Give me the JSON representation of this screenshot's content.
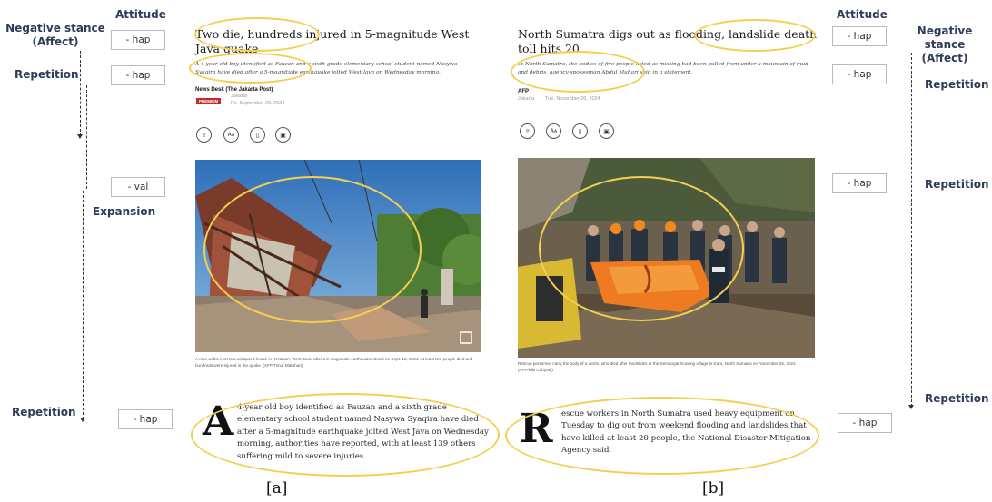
{
  "annotations": {
    "left": {
      "negative_stance": "Negative stance\n(Affect)",
      "attitude_header": "Attitude",
      "repetition_top": "Repetition",
      "expansion": "Expansion",
      "repetition_bottom": "Repetition",
      "tags": [
        "- hap",
        "- hap",
        "- val",
        "- hap"
      ]
    },
    "right": {
      "attitude_header": "Attitude",
      "negative_stance": "Negative stance\n(Affect)",
      "repetition_1": "Repetition",
      "repetition_2": "Repetition",
      "repetition_3": "Repetition",
      "tags": [
        "- hap",
        "- hap",
        "- hap",
        "- hap"
      ]
    },
    "ring_color": "#f4cf4f"
  },
  "panel_a": {
    "label": "[a]",
    "headline": "Two die, hundreds injured in 5-magnitude West Java quake",
    "subheadline": "A 4-year-old boy identified as Fauzan and a sixth grade elementary school student named Nasywa Syaqira have died after a 5-magnitude earthquake jolted West Java on Wednesday morning.",
    "source": "News Desk (The Jakarta Post)",
    "badge": "PREMIUM",
    "location": "Jakarta",
    "date": "Fri, September 20, 2024",
    "caption": "A man walks next to a collapsed house in Kertasari, West Java, after a 5-magnitude earthquake struck on Sept. 18, 2024. At least two people died and hundreds were injured in the quake. (AFP/Timur Matahari)",
    "dropcap": "A",
    "body": "4-year old boy identified as Fauzan and a sixth grade elementary school student named Nasywa Syaqira have died after a 5-magnitude earthquake jolted West Java on Wednesday morning, authorities have reported, with at least 139 others suffering mild to severe injuries.",
    "icons": [
      "share-icon",
      "font-size-icon",
      "bookmark-icon",
      "gift-icon"
    ],
    "icon_glyphs": [
      "⇪",
      "Aᴀ",
      "▯",
      "▣"
    ]
  },
  "panel_b": {
    "label": "[b]",
    "headline": "North Sumatra digs out as flooding, landslide death toll hits 20",
    "subheadline": "In North Sumatra, the bodies of five people listed as missing had been pulled from under a mountain of mud and debris, agency spokesman Abdul Muhari said in a statement.",
    "source": "AFP",
    "location": "Jakarta",
    "date": "Tue, November 26, 2024",
    "caption": "Rescue personnel carry the body of a victim, who died after landslides at the Semangat Gunung village in Karo, North Sumatra on November 25, 2024. (AFP/Kiki Cahyadi)",
    "dropcap": "R",
    "body": "escue workers in North Sumatra used heavy equipment on Tuesday to dig out from weekend flooding and landslides that have killed at least 20 people, the National Disaster Mitigation Agency said.",
    "icons": [
      "share-icon",
      "font-size-icon",
      "bookmark-icon",
      "gift-icon"
    ],
    "icon_glyphs": [
      "⇪",
      "Aᴀ",
      "▯",
      "▣"
    ]
  }
}
